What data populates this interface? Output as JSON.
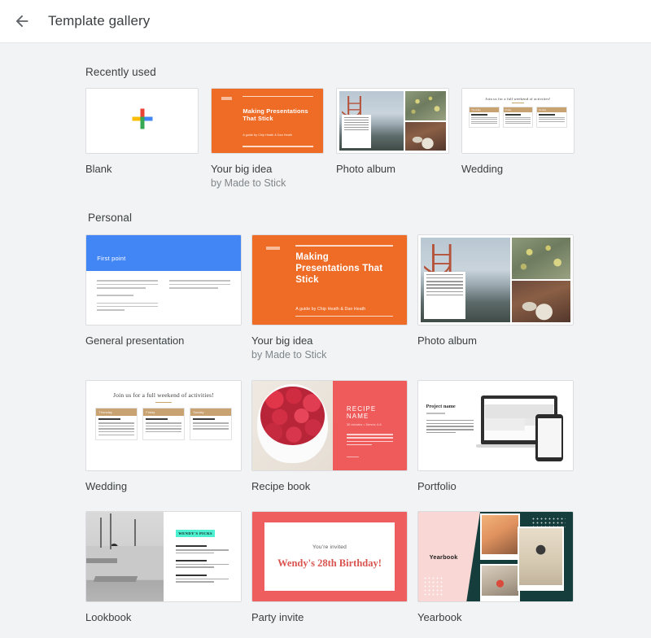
{
  "header": {
    "title": "Template gallery",
    "back_icon": "arrow-back-icon"
  },
  "sections": [
    {
      "id": "recently-used",
      "title": "Recently used",
      "items": [
        {
          "title": "Blank",
          "subtitle": "",
          "art": "blank"
        },
        {
          "title": "Your big idea",
          "subtitle": "by Made to Stick",
          "art": "bigidea"
        },
        {
          "title": "Photo album",
          "subtitle": "",
          "art": "photo"
        },
        {
          "title": "Wedding",
          "subtitle": "",
          "art": "wedding"
        }
      ]
    },
    {
      "id": "personal",
      "title": "Personal",
      "items": [
        {
          "title": "General presentation",
          "subtitle": "",
          "art": "general"
        },
        {
          "title": "Your big idea",
          "subtitle": "by Made to Stick",
          "art": "bigidea"
        },
        {
          "title": "Photo album",
          "subtitle": "",
          "art": "photo"
        },
        {
          "title": "Wedding",
          "subtitle": "",
          "art": "wedding"
        },
        {
          "title": "Recipe book",
          "subtitle": "",
          "art": "recipe"
        },
        {
          "title": "Portfolio",
          "subtitle": "",
          "art": "portfolio"
        },
        {
          "title": "Lookbook",
          "subtitle": "",
          "art": "lookbook"
        },
        {
          "title": "Party invite",
          "subtitle": "",
          "art": "party"
        },
        {
          "title": "Yearbook",
          "subtitle": "",
          "art": "yearbook"
        }
      ]
    }
  ],
  "thumbnail_text": {
    "bigidea": {
      "heading": "Making Presentations That Stick",
      "byline": "A guide by Chip Heath & Dan Heath"
    },
    "wedding": {
      "title": "Join us for a full weekend of activities!",
      "columns": [
        {
          "day": "Thursday",
          "event": "Spa at 5pm"
        },
        {
          "day": "Friday",
          "event": "Golf at 7am"
        },
        {
          "day": "Sunday",
          "event": "Brunch at Noon"
        }
      ]
    },
    "general": {
      "heading": "First point"
    },
    "recipe": {
      "title": "RECIPE NAME",
      "meta": "30 minutes • Serves 4-6"
    },
    "portfolio": {
      "title": "Project name"
    },
    "lookbook": {
      "badge": "WENDY'S PICKS"
    },
    "party": {
      "top": "You're invited",
      "main": "Wendy's 28th Birthday!"
    },
    "yearbook": {
      "title": "Yearbook"
    }
  },
  "colors": {
    "page_background": "#f1f3f4",
    "header_background": "#ffffff",
    "text_primary": "#3c4043",
    "text_secondary": "#80868b",
    "orange": "#ef6c26",
    "blue": "#4285f4",
    "coral": "#ef5b5b",
    "teal_accent": "#4df0d0",
    "yearbook_dark": "#143d3c",
    "yearbook_pink": "#f8d7d4",
    "wedding_gold": "#c9a271"
  }
}
